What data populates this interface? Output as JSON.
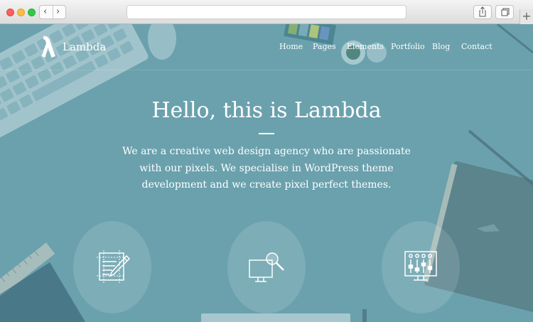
{
  "browser": {
    "buttons": {
      "back_icon": "‹",
      "forward_icon": "›",
      "new_tab_icon": "+"
    },
    "icons": [
      "share-icon",
      "tabs-icon"
    ]
  },
  "site": {
    "brand": "Lambda",
    "nav": [
      "Home",
      "Pages",
      "Elements",
      "Portfolio",
      "Blog",
      "Contact"
    ]
  },
  "hero": {
    "title": "Hello, this is Lambda",
    "intro": "We are a creative web design agency who are passionate with our pixels. We specialise in WordPress theme development and we create pixel perfect themes."
  },
  "features": [
    {
      "icon": "design-pencil-icon"
    },
    {
      "icon": "monitor-search-icon"
    },
    {
      "icon": "settings-sliders-icon"
    }
  ],
  "colors": {
    "overlay": "#6aa1ad",
    "text": "#ffffff",
    "chrome": "#e4e4e4",
    "accent": "#ffffff"
  }
}
